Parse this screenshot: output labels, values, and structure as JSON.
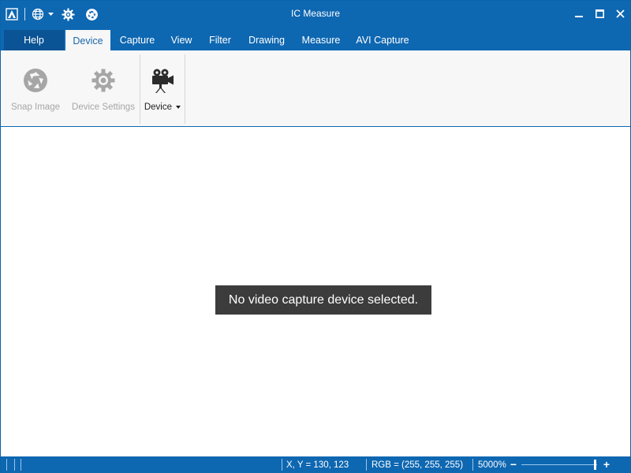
{
  "window": {
    "title": "IC Measure"
  },
  "quick_access": {
    "icons": [
      "app-logo-icon",
      "language-globe-icon",
      "dropdown-arrow-icon",
      "settings-gear-icon",
      "snap-shutter-icon"
    ]
  },
  "tabs": [
    {
      "label": "Help"
    },
    {
      "label": "Device"
    },
    {
      "label": "Capture"
    },
    {
      "label": "View"
    },
    {
      "label": "Filter"
    },
    {
      "label": "Drawing"
    },
    {
      "label": "Measure"
    },
    {
      "label": "AVI Capture"
    }
  ],
  "active_tab": "Device",
  "ribbon": {
    "snap_image": {
      "label": "Snap Image",
      "icon": "shutter-icon",
      "enabled": false
    },
    "device_settings": {
      "label": "Device Settings",
      "icon": "gear-icon",
      "enabled": false
    },
    "device": {
      "label": "Device",
      "icon": "video-camera-icon",
      "enabled": true
    }
  },
  "canvas": {
    "message": "No video capture device selected."
  },
  "status": {
    "coords": "X, Y = 130, 123",
    "rgb": "RGB = (255, 255, 255)",
    "zoom": "5000%",
    "zoom_out": "−",
    "zoom_in": "+"
  },
  "colors": {
    "accent": "#0e67b1",
    "help_tab": "#0a5394",
    "ribbon_bg": "#f7f7f7",
    "message_bg": "#3c3c3c"
  }
}
